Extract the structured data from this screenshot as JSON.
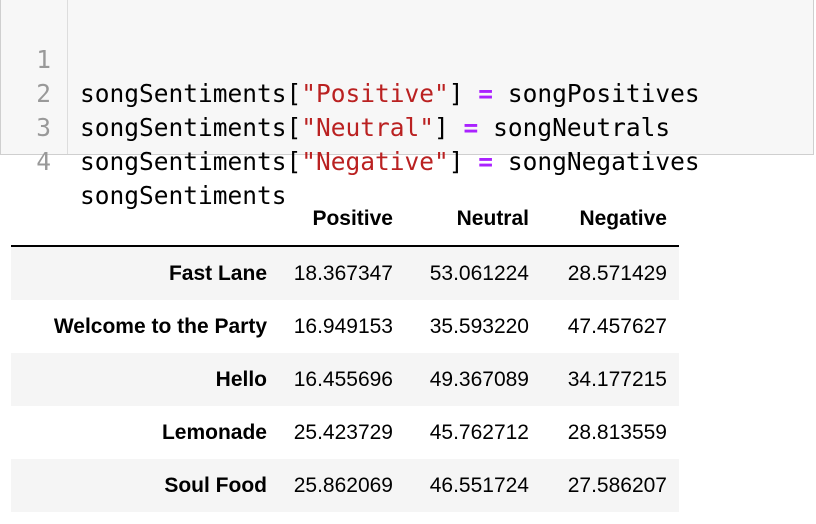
{
  "code_cell": {
    "lines": [
      {
        "num": "1",
        "var": "songSentiments[",
        "key": "\"Positive\"",
        "close": "] ",
        "op": "=",
        "rhs": " songPositives"
      },
      {
        "num": "2",
        "var": "songSentiments[",
        "key": "\"Neutral\"",
        "close": "] ",
        "op": "=",
        "rhs": " songNeutrals"
      },
      {
        "num": "3",
        "var": "songSentiments[",
        "key": "\"Negative\"",
        "close": "] ",
        "op": "=",
        "rhs": " songNegatives"
      },
      {
        "num": "4",
        "text": "songSentiments"
      }
    ]
  },
  "dataframe": {
    "columns": [
      "",
      "Positive",
      "Neutral",
      "Negative"
    ],
    "rows": [
      {
        "index": "Fast Lane",
        "values": [
          "18.367347",
          "53.061224",
          "28.571429"
        ]
      },
      {
        "index": "Welcome to the Party",
        "values": [
          "16.949153",
          "35.593220",
          "47.457627"
        ]
      },
      {
        "index": "Hello",
        "values": [
          "16.455696",
          "49.367089",
          "34.177215"
        ]
      },
      {
        "index": "Lemonade",
        "values": [
          "25.423729",
          "45.762712",
          "28.813559"
        ]
      },
      {
        "index": "Soul Food",
        "values": [
          "25.862069",
          "46.551724",
          "27.586207"
        ]
      }
    ]
  },
  "colors": {
    "string": "#ba2121",
    "operator": "#aa22ff",
    "line_number": "#999999",
    "code_bg": "#f7f7f7",
    "row_stripe": "#f5f5f5"
  }
}
